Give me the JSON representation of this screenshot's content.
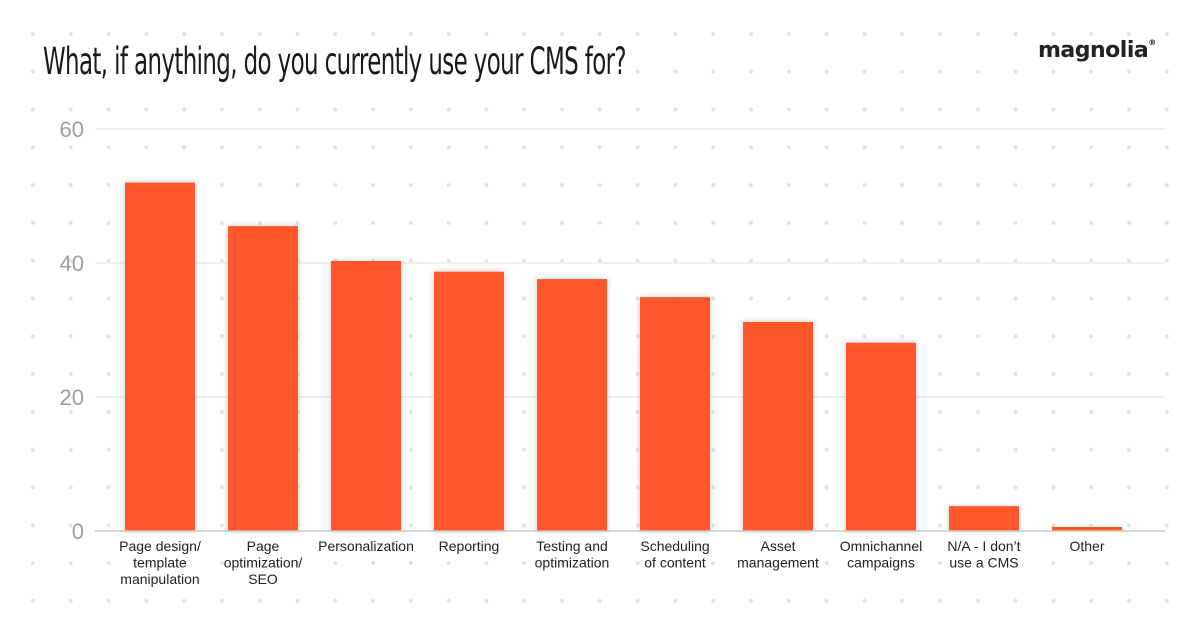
{
  "title": "What, if anything, do you currently use your CMS for?",
  "logo": {
    "text": "magnolia",
    "mark": "®"
  },
  "colors": {
    "bar": "#ff5629",
    "grid": "#ececec",
    "axis": "#c8c8c8",
    "tick_text": "#9e9e9e",
    "label_text": "#222222"
  },
  "chart_data": {
    "type": "bar",
    "title": "What, if anything, do you currently use your CMS for?",
    "xlabel": "",
    "ylabel": "",
    "ylim": [
      0,
      60
    ],
    "yticks": [
      0,
      20,
      40,
      60
    ],
    "grid": true,
    "legend": "none",
    "categories": [
      [
        "Page design/",
        "template",
        "manipulation"
      ],
      [
        "Page",
        "optimization/",
        "SEO"
      ],
      [
        "Personalization"
      ],
      [
        "Reporting"
      ],
      [
        "Testing and",
        "optimization"
      ],
      [
        "Scheduling",
        "of content"
      ],
      [
        "Asset",
        "management"
      ],
      [
        "Omnichannel",
        "campaigns"
      ],
      [
        "N/A - I don’t",
        "use a CMS"
      ],
      [
        "Other"
      ]
    ],
    "values": [
      52,
      45.5,
      40.3,
      38.7,
      37.6,
      34.9,
      31.2,
      28.1,
      3.7,
      0.6
    ]
  }
}
